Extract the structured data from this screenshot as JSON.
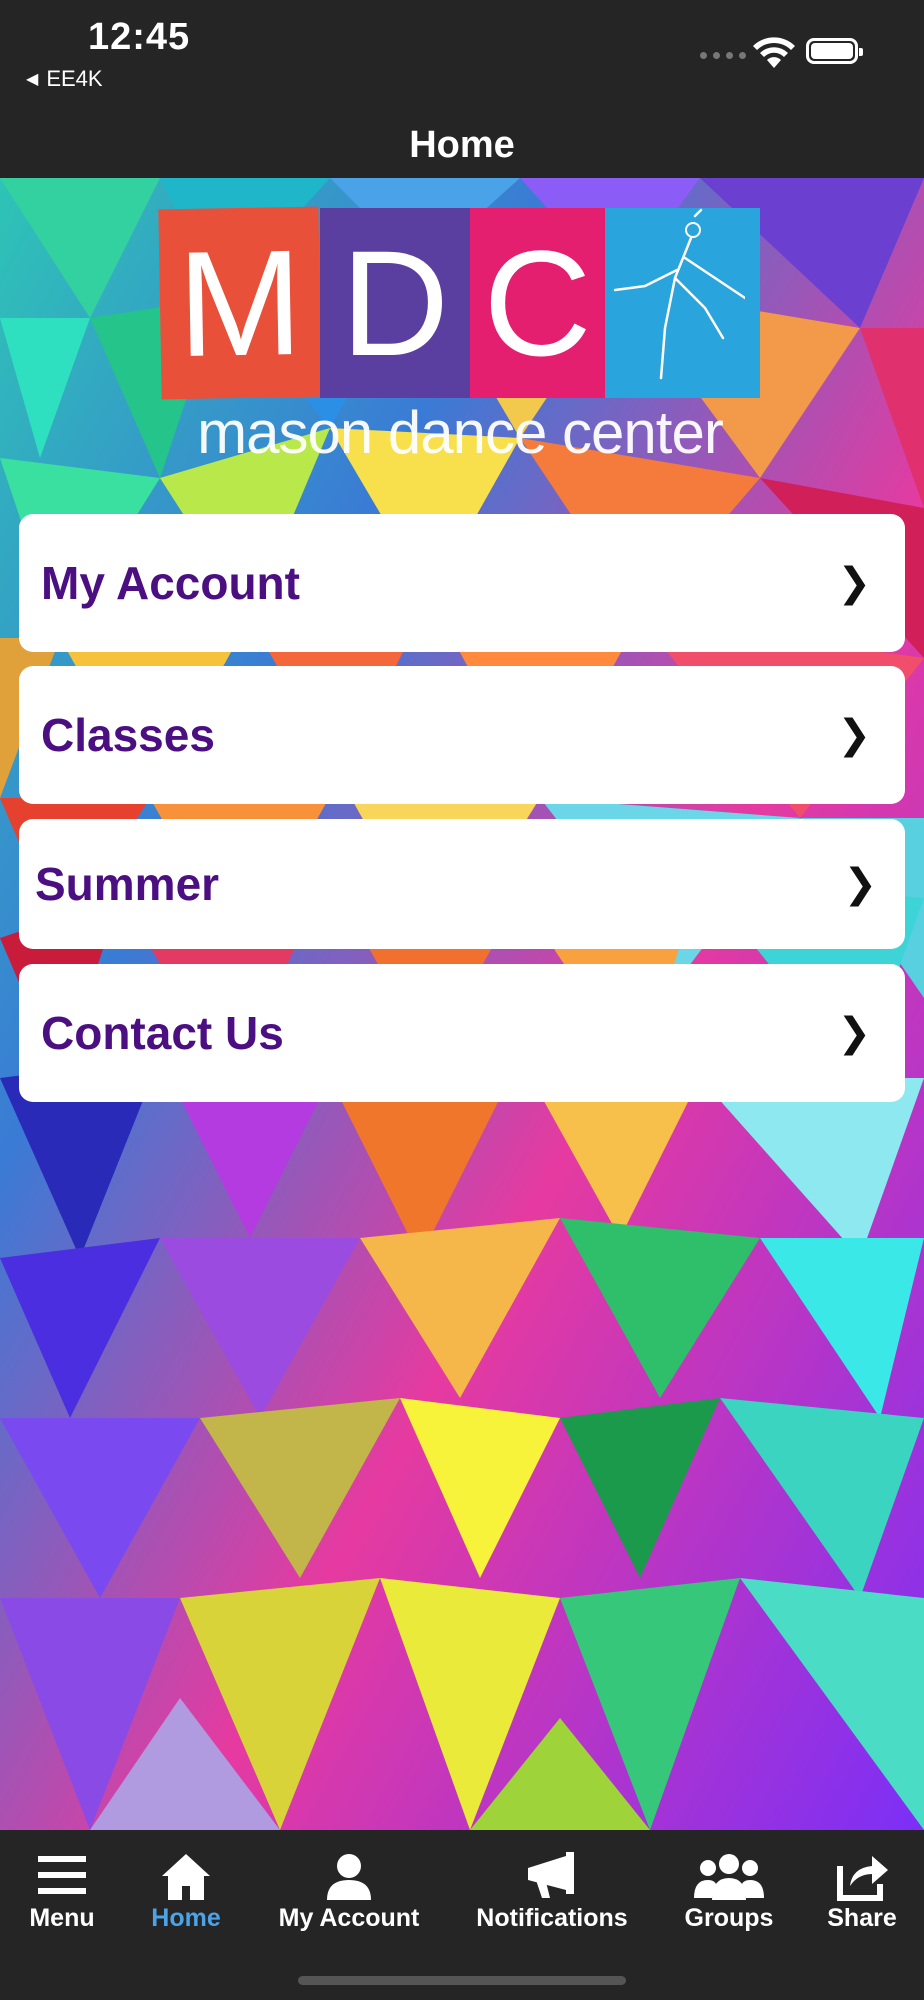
{
  "status_bar": {
    "time": "12:45",
    "carrier_back": "EE4K"
  },
  "nav": {
    "title": "Home"
  },
  "logo": {
    "letters": [
      "M",
      "D",
      "C"
    ],
    "tagline": "mason dance center",
    "colors": [
      "#e8503a",
      "#5a3ea0",
      "#e51f70",
      "#2aa4dc"
    ]
  },
  "menu": {
    "items": [
      {
        "label": "My Account",
        "chevron": "❯"
      },
      {
        "label": "Classes",
        "chevron": "❯"
      },
      {
        "label": "Summer",
        "chevron": "❯"
      },
      {
        "label": "Contact Us",
        "chevron": "❯"
      }
    ],
    "label_color": "#4b0f82"
  },
  "tabbar": {
    "active_color": "#4da3e6",
    "tabs": [
      {
        "label": "Menu",
        "icon": "hamburger-icon"
      },
      {
        "label": "Home",
        "icon": "home-icon"
      },
      {
        "label": "My Account",
        "icon": "person-icon"
      },
      {
        "label": "Notifications",
        "icon": "megaphone-icon"
      },
      {
        "label": "Groups",
        "icon": "group-icon"
      },
      {
        "label": "Share",
        "icon": "share-icon"
      }
    ]
  }
}
